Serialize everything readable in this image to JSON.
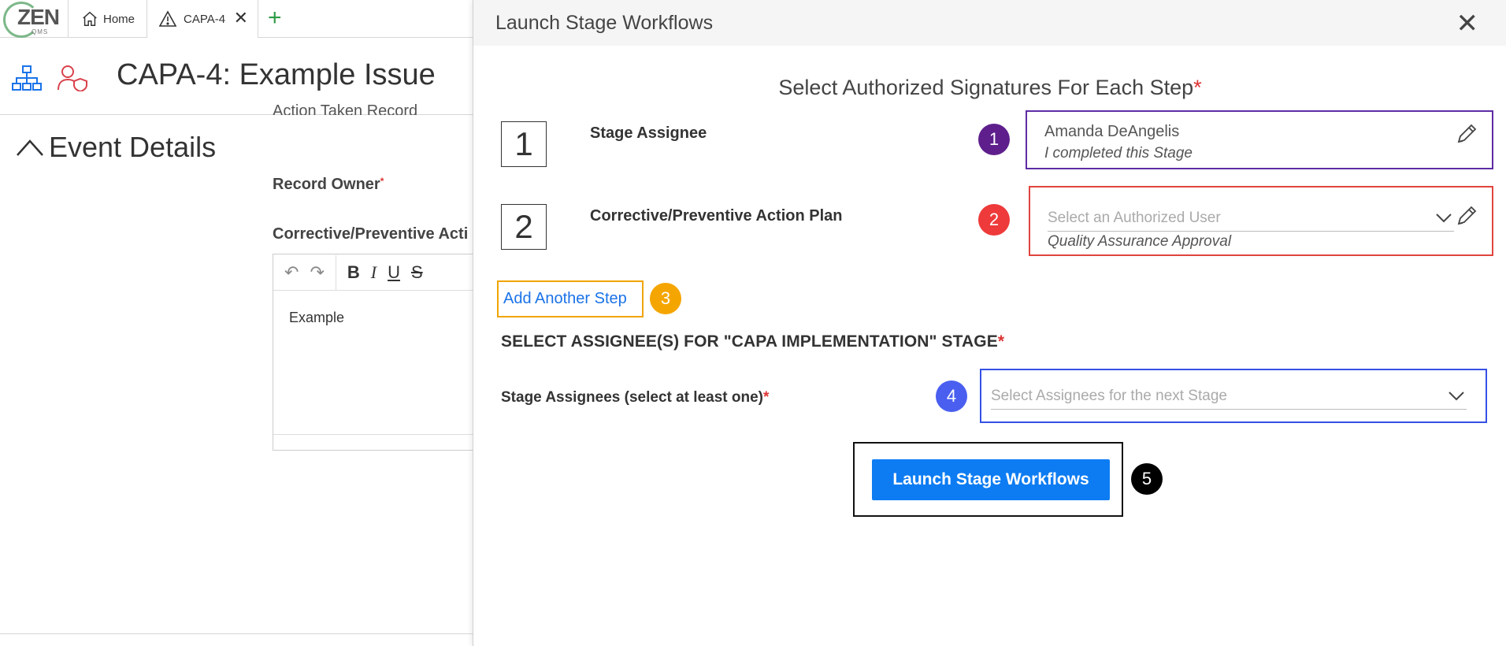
{
  "app": {
    "logo_text": "ZEN",
    "logo_sub": "QMS",
    "tabs": [
      {
        "label": "Home"
      },
      {
        "label": "CAPA-4"
      }
    ],
    "page_title": "CAPA-4: Example Issue",
    "section_title": "Event Details",
    "cut_label": "Action Taken Record",
    "record_owner_label": "Record Owner",
    "cap_label": "Corrective/Preventive Acti",
    "editor_content": "Example"
  },
  "modal": {
    "title": "Launch Stage Workflows",
    "signatures_heading": "Select Authorized Signatures For Each Step",
    "steps": [
      {
        "number": "1",
        "name": "Stage Assignee",
        "assignee": "Amanda DeAngelis",
        "note": "I completed this Stage"
      },
      {
        "number": "2",
        "name": "Corrective/Preventive Action Plan",
        "select_placeholder": "Select an Authorized User",
        "note": "Quality Assurance Approval"
      }
    ],
    "add_step_label": "Add Another Step",
    "assignees_heading": "SELECT ASSIGNEE(S) FOR \"CAPA IMPLEMENTATION\" STAGE",
    "assignees_label": "Stage Assignees (select at least one)",
    "assignees_placeholder": "Select Assignees for the next Stage",
    "launch_button": "Launch Stage Workflows",
    "required_mark": "*"
  },
  "callouts": [
    {
      "label": "1",
      "color": "#5e1f8c"
    },
    {
      "label": "2",
      "color": "#ee3a3a"
    },
    {
      "label": "3",
      "color": "#f5a500"
    },
    {
      "label": "4",
      "color": "#4a5ff0"
    },
    {
      "label": "5",
      "color": "#000000"
    }
  ],
  "box_colors": {
    "step1": "#5e2ca5",
    "step2": "#e0443d",
    "add_step": "#f0a500",
    "assignees": "#3551e6",
    "launch": "#111111"
  }
}
